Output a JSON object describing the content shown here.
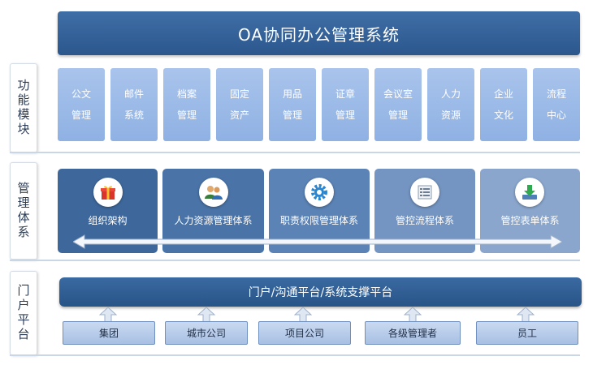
{
  "title": "OA协同办公管理系统",
  "sections": {
    "modules_label": "功能模块",
    "management_label": "管理体系",
    "portal_label": "门户平台"
  },
  "modules": [
    {
      "line1": "公文",
      "line2": "管理"
    },
    {
      "line1": "邮件",
      "line2": "系统"
    },
    {
      "line1": "档案",
      "line2": "管理"
    },
    {
      "line1": "固定",
      "line2": "资产"
    },
    {
      "line1": "用品",
      "line2": "管理"
    },
    {
      "line1": "证章",
      "line2": "管理"
    },
    {
      "line1": "会议室",
      "line2": "管理"
    },
    {
      "line1": "人力",
      "line2": "资源"
    },
    {
      "line1": "企业",
      "line2": "文化"
    },
    {
      "line1": "流程",
      "line2": "中心"
    }
  ],
  "systems": [
    {
      "label": "组织架构",
      "icon": "gift-box-icon",
      "color": "#3e689c"
    },
    {
      "label": "人力资源管理体系",
      "icon": "people-icon",
      "color": "#4a74a8"
    },
    {
      "label": "职责权限管理体系",
      "icon": "gear-icon",
      "color": "#5b83b6"
    },
    {
      "label": "管控流程体系",
      "icon": "list-document-icon",
      "color": "#7494c1"
    },
    {
      "label": "管控表单体系",
      "icon": "download-icon",
      "color": "#8aa6cd"
    }
  ],
  "portal": {
    "bar_label": "门户/沟通平台/系统支撑平台",
    "users": [
      "集团",
      "城市公司",
      "项目公司",
      "各级管理者",
      "员工"
    ]
  },
  "colors": {
    "title_bg": "#2f5b92",
    "module_bg": "#9bbbe8",
    "portal_bar_bg": "#30609a",
    "user_box_bg": "#b8cdea"
  }
}
